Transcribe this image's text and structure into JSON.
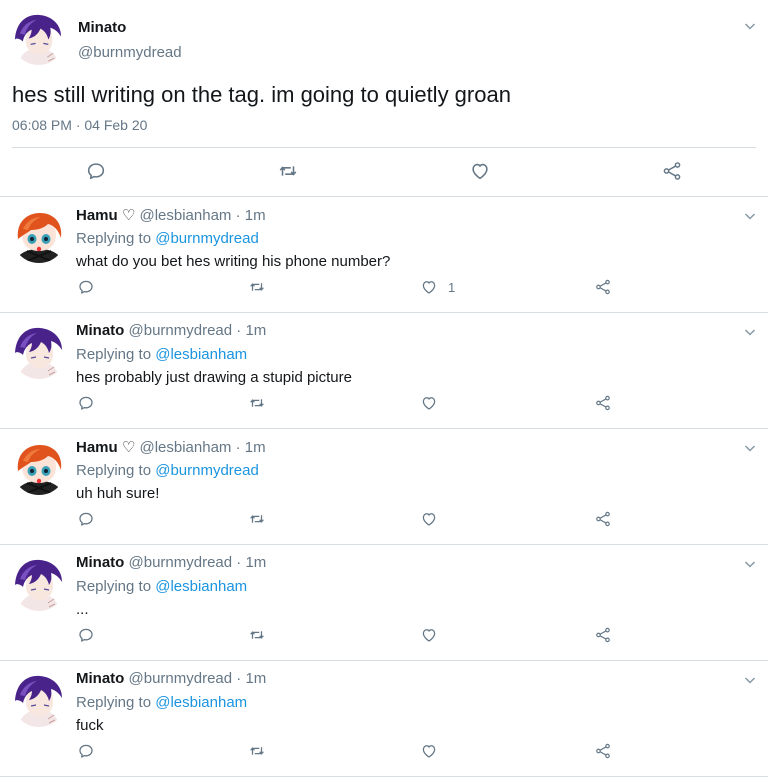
{
  "main_tweet": {
    "name": "Minato",
    "handle": "@burnmydread",
    "text": "hes still writing on the tag. im going to quietly groan",
    "timestamp": "06:08 PM · 04 Feb 20",
    "icons": [
      "reply-icon",
      "retweet-icon",
      "like-icon",
      "share-icon",
      "chevron-down-icon"
    ]
  },
  "replies": [
    {
      "name": "Hamu ♡",
      "handle": "@lesbianham",
      "time": "1m",
      "replying_label": "Replying to",
      "replying_to": "@burnmydread",
      "text": "what do you bet hes writing his phone number?",
      "like_count": "1",
      "avatar": "hamu"
    },
    {
      "name": "Minato",
      "handle": "@burnmydread",
      "time": "1m",
      "replying_label": "Replying to",
      "replying_to": "@lesbianham",
      "text": "hes probably just drawing a stupid picture",
      "like_count": "",
      "avatar": "minato"
    },
    {
      "name": "Hamu ♡",
      "handle": "@lesbianham",
      "time": "1m",
      "replying_label": "Replying to",
      "replying_to": "@burnmydread",
      "text": "uh huh sure!",
      "like_count": "",
      "avatar": "hamu"
    },
    {
      "name": "Minato",
      "handle": "@burnmydread",
      "time": "1m",
      "replying_label": "Replying to",
      "replying_to": "@lesbianham",
      "text": "...",
      "like_count": "",
      "avatar": "minato"
    },
    {
      "name": "Minato",
      "handle": "@burnmydread",
      "time": "1m",
      "replying_label": "Replying to",
      "replying_to": "@lesbianham",
      "text": "fuck",
      "like_count": "",
      "avatar": "minato"
    }
  ],
  "colors": {
    "link": "#1b95e0",
    "secondary_text": "#657786",
    "divider": "#d8dde2",
    "icon": "#657786"
  }
}
